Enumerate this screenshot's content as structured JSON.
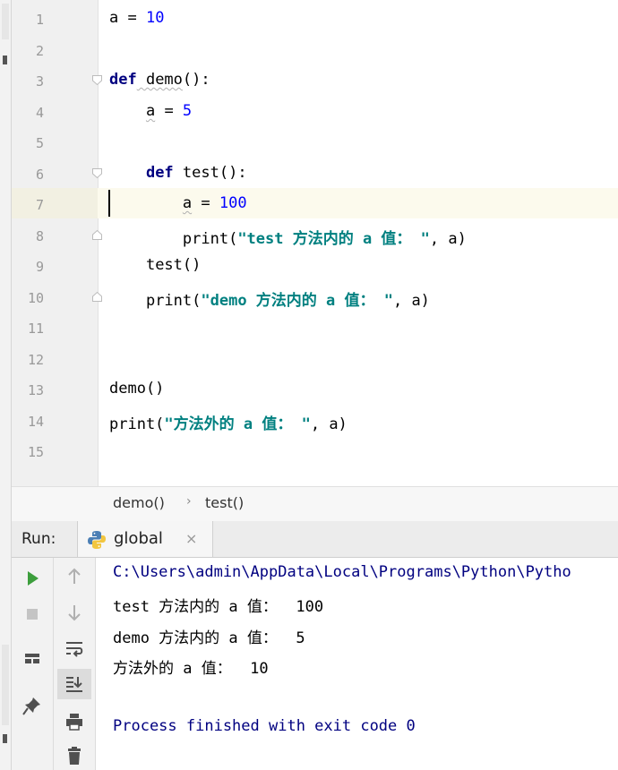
{
  "editor": {
    "line_numbers": [
      "1",
      "2",
      "3",
      "4",
      "5",
      "6",
      "7",
      "8",
      "9",
      "10",
      "11",
      "12",
      "13",
      "14",
      "15"
    ],
    "lines": {
      "l1": {
        "a": "a",
        "eq": " = ",
        "num": "10"
      },
      "l3": {
        "kw": "def",
        "name": " demo",
        "paren": "():"
      },
      "l4": {
        "indent": "    ",
        "a": "a",
        "eq": " = ",
        "num": "5"
      },
      "l6": {
        "indent": "    ",
        "kw": "def",
        "name": " test",
        "paren": "():"
      },
      "l7": {
        "indent": "        ",
        "a": "a",
        "eq": " = ",
        "num": "100"
      },
      "l8": {
        "indent": "        ",
        "fn": "print(",
        "str": "\"test 方法内的 a 值： \"",
        "rest": ", a)"
      },
      "l9": {
        "indent": "    ",
        "fn": "test()"
      },
      "l10": {
        "indent": "    ",
        "fn": "print(",
        "str": "\"demo 方法内的 a 值： \"",
        "rest": ", a)"
      },
      "l13": {
        "fn": "demo()"
      },
      "l14": {
        "fn": "print(",
        "str": "\"方法外的 a 值： \"",
        "rest": ", a)"
      }
    }
  },
  "breadcrumb": {
    "item1": "demo()",
    "sep": "›",
    "item2": "test()"
  },
  "run": {
    "label": "Run:",
    "tab_title": "global",
    "close": "×",
    "output": [
      "C:\\Users\\admin\\AppData\\Local\\Programs\\Python\\Pytho",
      "test 方法内的 a 值：  100",
      "demo 方法内的 a 值：  5",
      "方法外的 a 值：  10",
      "",
      "Process finished with exit code 0"
    ]
  },
  "colors": {
    "keyword": "#000080",
    "number": "#0000ff",
    "string": "#008080",
    "path": "#000080",
    "run_green": "#3c9e3c",
    "stop_gray": "#9a9a9a"
  },
  "icons": [
    "run-icon",
    "stop-icon",
    "rerun-layout-icon",
    "pin-icon",
    "up-arrow-icon",
    "down-arrow-icon",
    "soft-wrap-icon",
    "scroll-to-end-icon",
    "print-icon",
    "trash-icon",
    "python-icon",
    "close-icon"
  ]
}
